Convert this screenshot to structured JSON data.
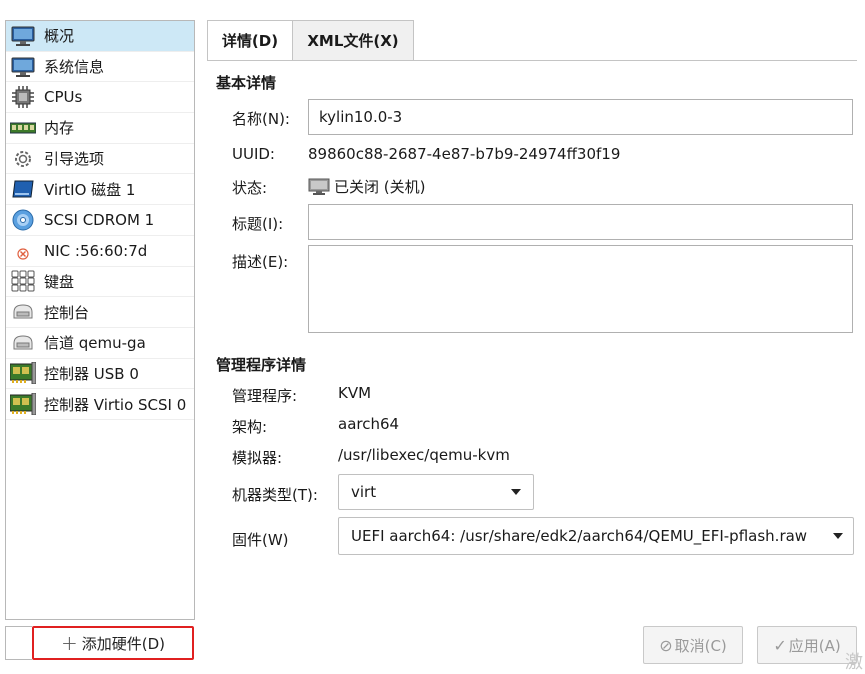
{
  "sidebar": {
    "items": [
      {
        "label": "概况",
        "icon": "monitor-icon",
        "selected": true
      },
      {
        "label": "系统信息",
        "icon": "monitor-icon"
      },
      {
        "label": "CPUs",
        "icon": "cpu-chip-icon"
      },
      {
        "label": "内存",
        "icon": "memory-module-icon"
      },
      {
        "label": "引导选项",
        "icon": "gear-icon"
      },
      {
        "label": "VirtIO 磁盘 1",
        "icon": "disk-icon"
      },
      {
        "label": "SCSI CDROM 1",
        "icon": "cdrom-icon"
      },
      {
        "label": "NIC :56:60:7d",
        "icon": "nic-disconnected-icon"
      },
      {
        "label": "键盘",
        "icon": "keyboard-icon"
      },
      {
        "label": "控制台",
        "icon": "serial-console-icon"
      },
      {
        "label": "信道 qemu-ga",
        "icon": "serial-console-icon"
      },
      {
        "label": "控制器 USB 0",
        "icon": "controller-card-icon"
      },
      {
        "label": "控制器 Virtio SCSI 0",
        "icon": "controller-card-icon"
      }
    ],
    "add_hardware_label": "添加硬件(D)"
  },
  "tabs": {
    "details": "详情(D)",
    "xml": "XML文件(X)"
  },
  "basic": {
    "title": "基本详情",
    "name_label": "名称(N):",
    "name_value": "kylin10.0-3",
    "uuid_label": "UUID:",
    "uuid_value": "89860c88-2687-4e87-b7b9-24974ff30f19",
    "status_label": "状态:",
    "status_value": "已关闭 (关机)",
    "title_label": "标题(I):",
    "title_value": "",
    "desc_label": "描述(E):",
    "desc_value": ""
  },
  "hypervisor": {
    "title": "管理程序详情",
    "hv_label": "管理程序:",
    "hv_value": "KVM",
    "arch_label": "架构:",
    "arch_value": "aarch64",
    "emu_label": "模拟器:",
    "emu_value": "/usr/libexec/qemu-kvm",
    "machine_label": "机器类型(T):",
    "machine_value": "virt",
    "firmware_label": "固件(W)",
    "firmware_value": "UEFI aarch64: /usr/share/edk2/aarch64/QEMU_EFI-pflash.raw"
  },
  "buttons": {
    "cancel": "取消(C)",
    "apply": "应用(A)"
  },
  "watermark": "激",
  "colors": {
    "selected_bg": "#cde8f6",
    "highlight_border": "#e02020"
  }
}
